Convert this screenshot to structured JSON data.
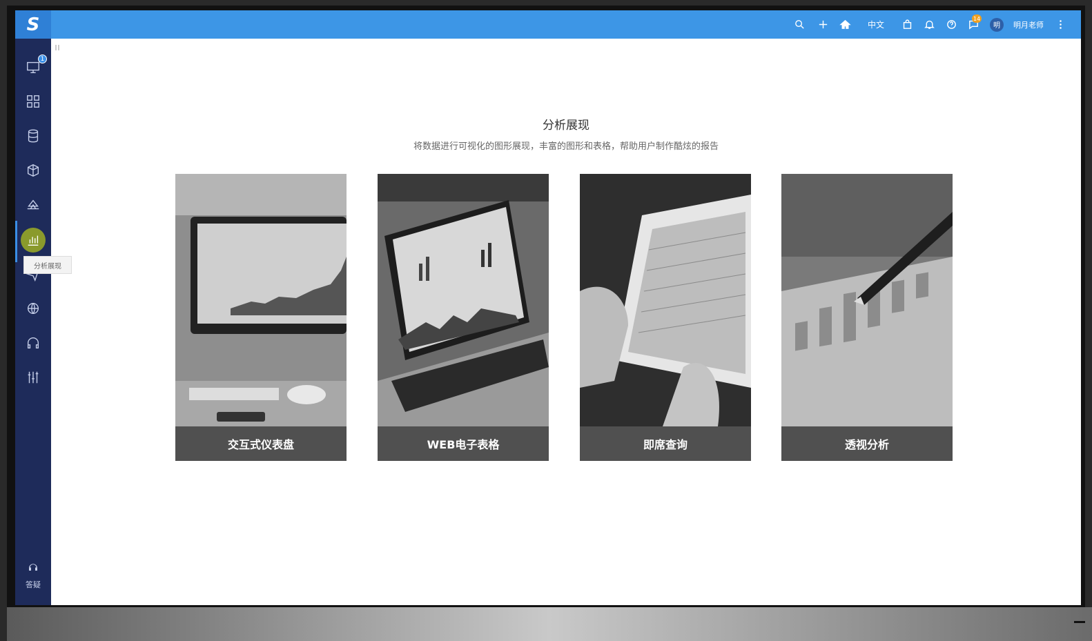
{
  "sidebar": {
    "logo_text": "S",
    "monitor_badge": "1",
    "tooltip": "分析展现",
    "help_label": "答疑",
    "items": [
      {
        "icon": "monitor-icon"
      },
      {
        "icon": "apps-icon"
      },
      {
        "icon": "database-icon"
      },
      {
        "icon": "cubes-icon"
      },
      {
        "icon": "layers-icon"
      },
      {
        "icon": "bar-chart-icon"
      },
      {
        "icon": "send-icon"
      },
      {
        "icon": "globe-icon"
      },
      {
        "icon": "headset-icon"
      },
      {
        "icon": "tools-icon"
      }
    ]
  },
  "topbar": {
    "language": "中文",
    "message_badge": "14",
    "avatar_initial": "明",
    "username": "明月老师",
    "accent_color": "#3d96e6"
  },
  "main": {
    "title": "分析展现",
    "subtitle": "将数据进行可视化的图形展现，丰富的图形和表格，帮助用户制作酷炫的报告",
    "cards": [
      {
        "label": "交互式仪表盘",
        "image": "desktop-monitor-photo"
      },
      {
        "label": "WEB电子表格",
        "image": "laptop-charts-photo"
      },
      {
        "label": "即席查询",
        "image": "tablet-table-photo"
      },
      {
        "label": "透视分析",
        "image": "pen-bar-chart-photo"
      }
    ]
  }
}
